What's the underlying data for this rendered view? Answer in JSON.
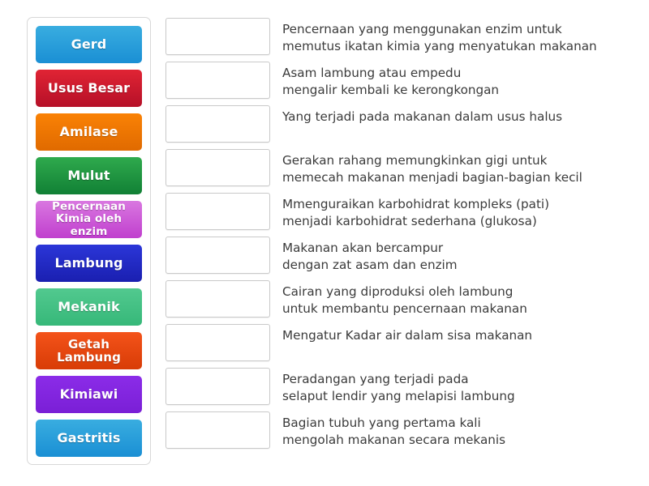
{
  "activity": {
    "type": "match-up",
    "background_color": "#ffffff"
  },
  "tiles_panel": {
    "border_color": "#d8d8d8",
    "items": [
      {
        "label": "Gerd",
        "color_top": "#39ade0",
        "color_bottom": "#1a8fd4",
        "lines": 1
      },
      {
        "label": "Usus Besar",
        "color_top": "#e02434",
        "color_bottom": "#b61028",
        "lines": 1
      },
      {
        "label": "Amilase",
        "color_top": "#fa8205",
        "color_bottom": "#e06a00",
        "lines": 1
      },
      {
        "label": "Mulut",
        "color_top": "#2faa4d",
        "color_bottom": "#118035",
        "lines": 1
      },
      {
        "label": "Pencernaan\nKimia oleh enzim",
        "color_top": "#d977e0",
        "color_bottom": "#c03fce",
        "lines": 2
      },
      {
        "label": "Lambung",
        "color_top": "#2b36d8",
        "color_bottom": "#1a1fb0",
        "lines": 1
      },
      {
        "label": "Mekanik",
        "color_top": "#52c98f",
        "color_bottom": "#36b879",
        "lines": 1
      },
      {
        "label": "Getah\nLambung",
        "color_top": "#f4531a",
        "color_bottom": "#d83c06",
        "lines": 2
      },
      {
        "label": "Kimiawi",
        "color_top": "#8b2ce8",
        "color_bottom": "#7a1fd6",
        "lines": 1
      },
      {
        "label": "Gastritis",
        "color_top": "#39ade0",
        "color_bottom": "#1a8fd4",
        "lines": 1
      }
    ]
  },
  "answers": {
    "slot_border_color": "#c9c9c9",
    "rows": [
      {
        "slot_value": "",
        "text": "Pencernaan yang menggunakan enzim untuk\nmemutus ikatan kimia yang menyatukan makanan"
      },
      {
        "slot_value": "",
        "text": "Asam lambung atau empedu\nmengalir kembali ke kerongkongan"
      },
      {
        "slot_value": "",
        "text": "Yang terjadi pada makanan dalam usus halus"
      },
      {
        "slot_value": "",
        "text": "Gerakan rahang memungkinkan gigi untuk\nmemecah makanan menjadi bagian-bagian kecil"
      },
      {
        "slot_value": "",
        "text": "Mmenguraikan karbohidrat kompleks (pati)\nmenjadi karbohidrat sederhana (glukosa)"
      },
      {
        "slot_value": "",
        "text": "Makanan akan bercampur\ndengan zat asam dan enzim"
      },
      {
        "slot_value": "",
        "text": "Cairan yang diproduksi oleh lambung\nuntuk membantu pencernaan makanan"
      },
      {
        "slot_value": "",
        "text": "Mengatur Kadar air dalam sisa makanan"
      },
      {
        "slot_value": "",
        "text": "Peradangan yang terjadi pada\nselaput lendir yang melapisi lambung"
      },
      {
        "slot_value": "",
        "text": "Bagian tubuh yang pertama kali\nmengolah makanan secara mekanis"
      }
    ]
  }
}
